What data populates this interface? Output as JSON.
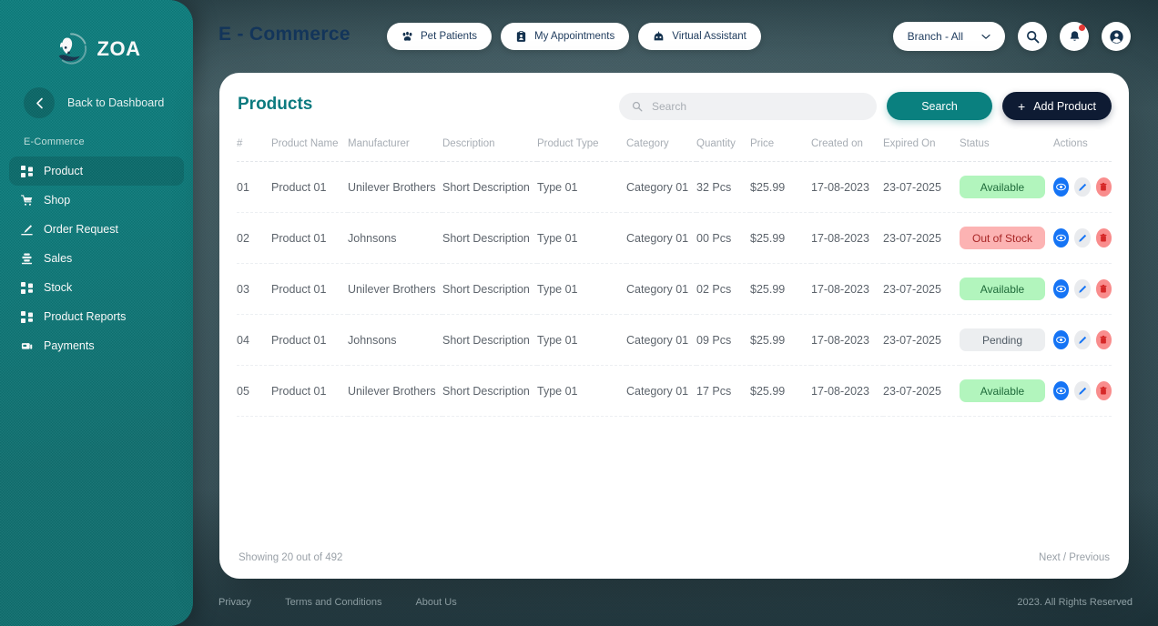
{
  "sidebar": {
    "logo_text": "ZOA",
    "logo_icon": "dog-head-logo-icon",
    "back_label": "Back to Dashboard",
    "section_label": "E-Commerce",
    "items": [
      {
        "label": "Product",
        "icon": "grid-icon",
        "active": true
      },
      {
        "label": "Shop",
        "icon": "cart-icon",
        "active": false
      },
      {
        "label": "Order Request",
        "icon": "pen-icon",
        "active": false
      },
      {
        "label": "Sales",
        "icon": "stack-icon",
        "active": false
      },
      {
        "label": "Stock",
        "icon": "grid-icon",
        "active": false
      },
      {
        "label": "Product Reports",
        "icon": "grid-icon",
        "active": false
      },
      {
        "label": "Payments",
        "icon": "payment-icon",
        "active": false
      }
    ]
  },
  "topbar": {
    "brand_title": "E - Commerce",
    "pills": [
      {
        "label": "Pet Patients",
        "icon": "paw-icon"
      },
      {
        "label": "My Appointments",
        "icon": "clipboard-icon"
      },
      {
        "label": "Virtual Assistant",
        "icon": "robot-icon"
      }
    ],
    "branch_label": "Branch - All",
    "branch_caret": "chevron-down-icon",
    "search_icon": "search-icon",
    "bell_icon": "bell-icon",
    "account_icon": "account-icon"
  },
  "card": {
    "title": "Products",
    "search_placeholder": "Search",
    "search_value": "",
    "search_button": "Search",
    "add_button": "Add Product",
    "add_plus": "+",
    "columns": [
      "#",
      "Product Name",
      "Manufacturer",
      "Description",
      "Product Type",
      "Category",
      "Quantity",
      "Price",
      "Created on",
      "Expired On",
      "Status",
      "Actions"
    ],
    "rows": [
      {
        "num": "01",
        "name": "Product 01",
        "manufacturer": "Unilever Brothers",
        "description": "Short Description",
        "type": "Type 01",
        "category": "Category 01",
        "quantity": "32 Pcs",
        "price": "$25.99",
        "created": "17-08-2023",
        "expired": "23-07-2025",
        "status": "Available",
        "status_kind": "available"
      },
      {
        "num": "02",
        "name": "Product 01",
        "manufacturer": "Johnsons",
        "description": "Short Description",
        "type": "Type 01",
        "category": "Category 01",
        "quantity": "00 Pcs",
        "price": "$25.99",
        "created": "17-08-2023",
        "expired": "23-07-2025",
        "status": "Out of Stock",
        "status_kind": "out"
      },
      {
        "num": "03",
        "name": "Product 01",
        "manufacturer": "Unilever Brothers",
        "description": "Short Description",
        "type": "Type 01",
        "category": "Category 01",
        "quantity": "02 Pcs",
        "price": "$25.99",
        "created": "17-08-2023",
        "expired": "23-07-2025",
        "status": "Available",
        "status_kind": "available"
      },
      {
        "num": "04",
        "name": "Product 01",
        "manufacturer": "Johnsons",
        "description": "Short Description",
        "type": "Type 01",
        "category": "Category 01",
        "quantity": "09 Pcs",
        "price": "$25.99",
        "created": "17-08-2023",
        "expired": "23-07-2025",
        "status": "Pending",
        "status_kind": "pending"
      },
      {
        "num": "05",
        "name": "Product 01",
        "manufacturer": "Unilever Brothers",
        "description": "Short Description",
        "type": "Type 01",
        "category": "Category 01",
        "quantity": "17 Pcs",
        "price": "$25.99",
        "created": "17-08-2023",
        "expired": "23-07-2025",
        "status": "Available",
        "status_kind": "available"
      }
    ],
    "row_actions": [
      {
        "icon": "eye-icon",
        "kind": "view"
      },
      {
        "icon": "pencil-icon",
        "kind": "edit"
      },
      {
        "icon": "trash-icon",
        "kind": "del"
      }
    ],
    "showing_text": "Showing 20 out of 492",
    "pager_text": "Next / Previous"
  },
  "footer": {
    "links": [
      "Privacy",
      "Terms and Conditions",
      "About Us"
    ],
    "copyright": "2023. All Rights Reserved"
  },
  "colors": {
    "sidebar_teal": "#0d7d7d",
    "accent_teal": "#0a807f",
    "title_teal": "#0b7a7f",
    "dark_navy": "#0e1b33",
    "brand_navy": "#13355a",
    "badge_available_bg": "#b2f5bd",
    "badge_out_bg": "#fcb3b3",
    "badge_pending_bg": "#eceef0",
    "action_view": "#1574f5",
    "action_edit": "#e9ebee",
    "action_delete": "#f98d8d",
    "page_bg": "#4c6970"
  }
}
